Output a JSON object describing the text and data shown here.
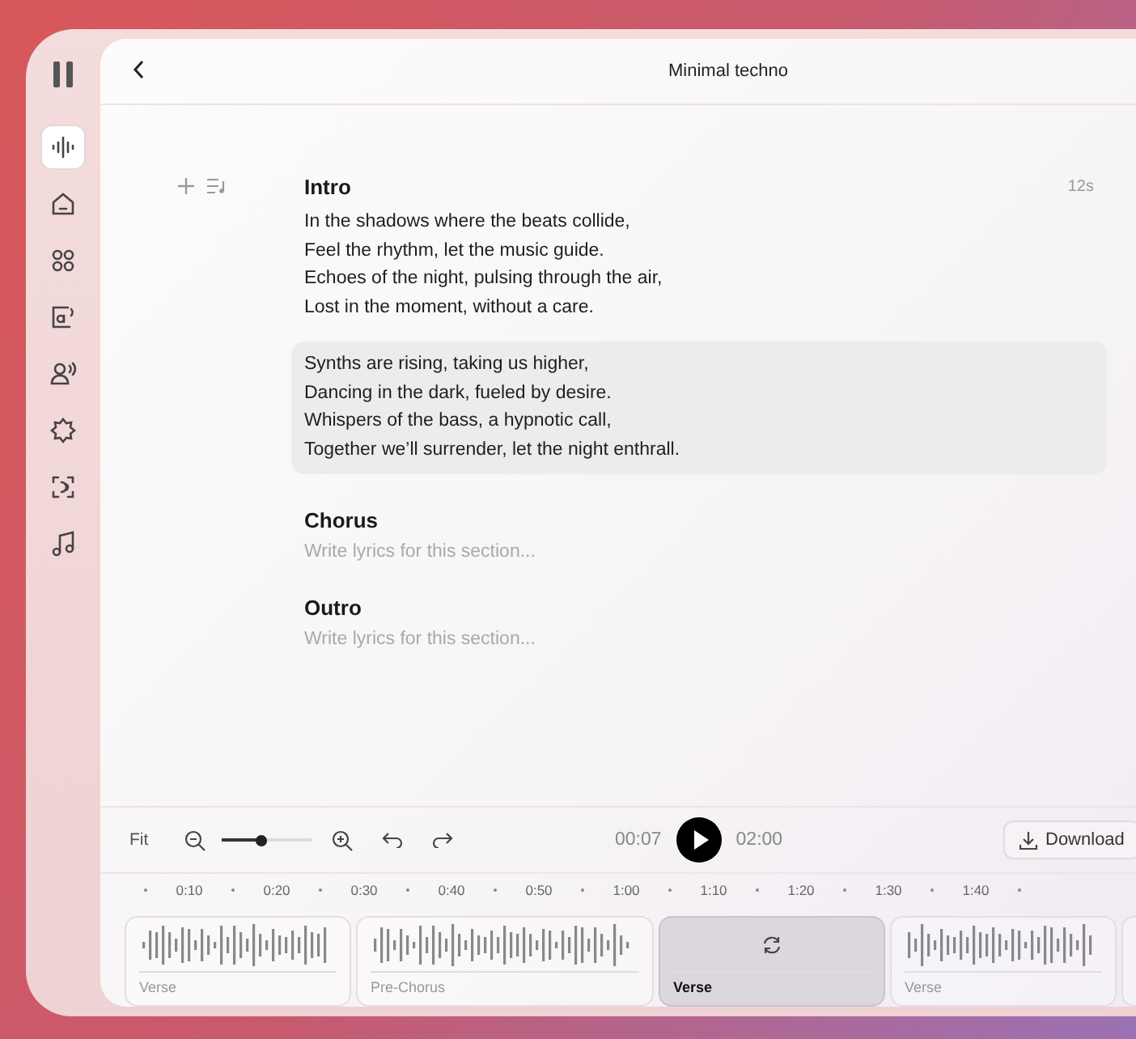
{
  "header": {
    "title": "Minimal techno"
  },
  "sidebar": {
    "items": [
      {
        "kind": "wave",
        "selected": true
      },
      {
        "kind": "home",
        "selected": false
      },
      {
        "kind": "grid",
        "selected": false
      },
      {
        "kind": "speech",
        "selected": false
      },
      {
        "kind": "voice",
        "selected": false
      },
      {
        "kind": "gear",
        "selected": false
      },
      {
        "kind": "scan",
        "selected": false
      },
      {
        "kind": "music",
        "selected": false
      }
    ]
  },
  "sections": [
    {
      "title": "Intro",
      "duration": "12s",
      "stanzas": [
        {
          "highlighted": false,
          "lines": [
            "In the shadows where the beats collide,",
            "Feel the rhythm, let the music guide.",
            "Echoes of the night, pulsing through the air,",
            "Lost in the moment, without a care."
          ]
        },
        {
          "highlighted": true,
          "lines": [
            "Synths are rising, taking us higher,",
            "Dancing in the dark, fueled by desire.",
            "Whispers of the bass, a hypnotic call,",
            "Together we’ll surrender, let the night enthrall."
          ]
        }
      ]
    },
    {
      "title": "Chorus",
      "placeholder": "Write lyrics for this section..."
    },
    {
      "title": "Outro",
      "placeholder": "Write lyrics for this section..."
    }
  ],
  "toolbar": {
    "fit": "Fit",
    "zoom": {
      "level": 0.45
    },
    "current_time": "00:07",
    "total_time": "02:00",
    "download": "Download"
  },
  "ruler": [
    "0:10",
    "0:20",
    "0:30",
    "0:40",
    "0:50",
    "1:00",
    "1:10",
    "1:20",
    "1:30",
    "1:40"
  ],
  "clips": [
    {
      "label": "Verse",
      "selected": false
    },
    {
      "label": "Pre-Chorus",
      "selected": false
    },
    {
      "label": "Verse",
      "selected": true
    },
    {
      "label": "Verse",
      "selected": false
    },
    {
      "selected": false
    }
  ]
}
